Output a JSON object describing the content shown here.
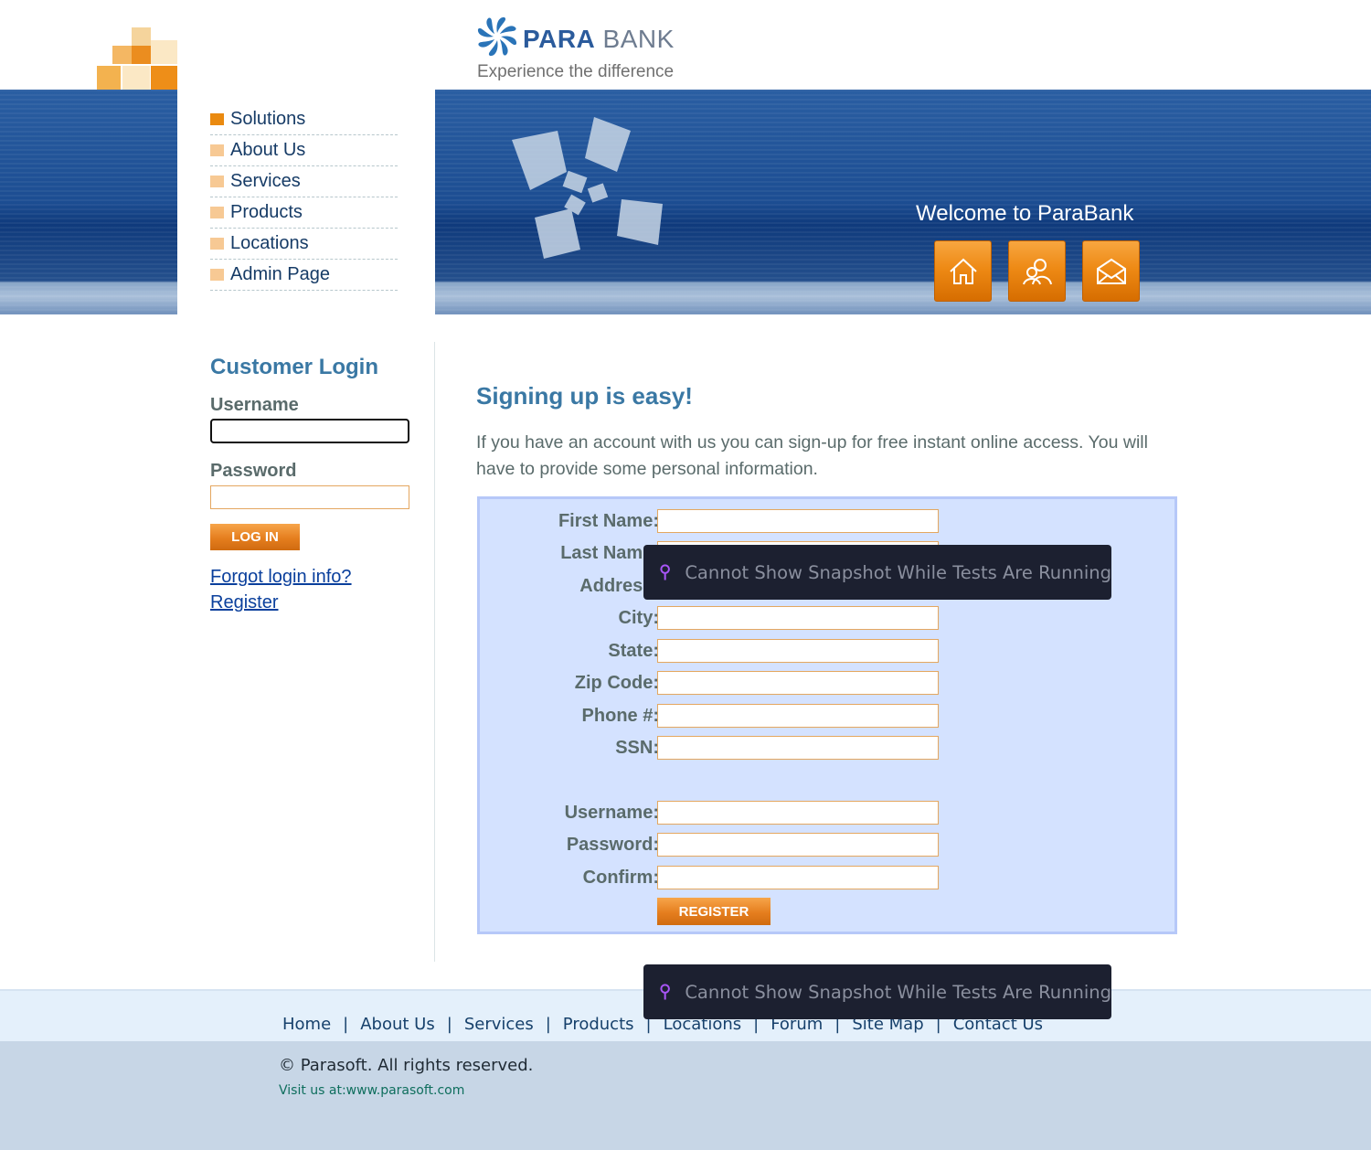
{
  "header": {
    "brand_para": "PARA",
    "brand_bank": "BANK",
    "caption": "Experience the difference",
    "welcome": "Welcome to ParaBank"
  },
  "left_nav": {
    "items": [
      {
        "label": "Solutions"
      },
      {
        "label": "About Us"
      },
      {
        "label": "Services"
      },
      {
        "label": "Products"
      },
      {
        "label": "Locations"
      },
      {
        "label": "Admin Page"
      }
    ]
  },
  "banner_buttons": [
    {
      "icon": "home-icon"
    },
    {
      "icon": "about-icon"
    },
    {
      "icon": "contact-icon"
    }
  ],
  "login": {
    "title": "Customer Login",
    "username_label": "Username",
    "username_value": "",
    "password_label": "Password",
    "password_value": "",
    "login_button": "LOG IN",
    "forgot_link": "Forgot login info?",
    "register_link": "Register"
  },
  "main": {
    "title": "Signing up is easy!",
    "intro": "If you have an account with us you can sign-up for free instant online access. You will have to provide some personal information.",
    "fields": {
      "first_name": {
        "label": "First Name:",
        "value": ""
      },
      "last_name": {
        "label": "Last Name:",
        "value": ""
      },
      "address": {
        "label": "Address:",
        "value": ""
      },
      "city": {
        "label": "City:",
        "value": ""
      },
      "state": {
        "label": "State:",
        "value": ""
      },
      "zip": {
        "label": "Zip Code:",
        "value": ""
      },
      "phone": {
        "label": "Phone #:",
        "value": ""
      },
      "ssn": {
        "label": "SSN:",
        "value": ""
      },
      "username": {
        "label": "Username:",
        "value": ""
      },
      "password": {
        "label": "Password:",
        "value": ""
      },
      "confirm": {
        "label": "Confirm:",
        "value": ""
      }
    },
    "register_button": "REGISTER"
  },
  "overlays": {
    "toast_text": "Cannot Show Snapshot While Tests Are Running",
    "accent_color": "#a855f7"
  },
  "footer": {
    "links": [
      "Home",
      "About Us",
      "Services",
      "Products",
      "Locations",
      "Forum",
      "Site Map",
      "Contact Us"
    ],
    "separator": "|",
    "copyright": "© Parasoft. All rights reserved.",
    "visit": "Visit us at:www.parasoft.com"
  },
  "colors": {
    "accent_orange": "#e57e1e",
    "heading_blue": "#3a78a4",
    "banner_blue": "#1c4d92",
    "form_bg": "#d4e2ff"
  }
}
